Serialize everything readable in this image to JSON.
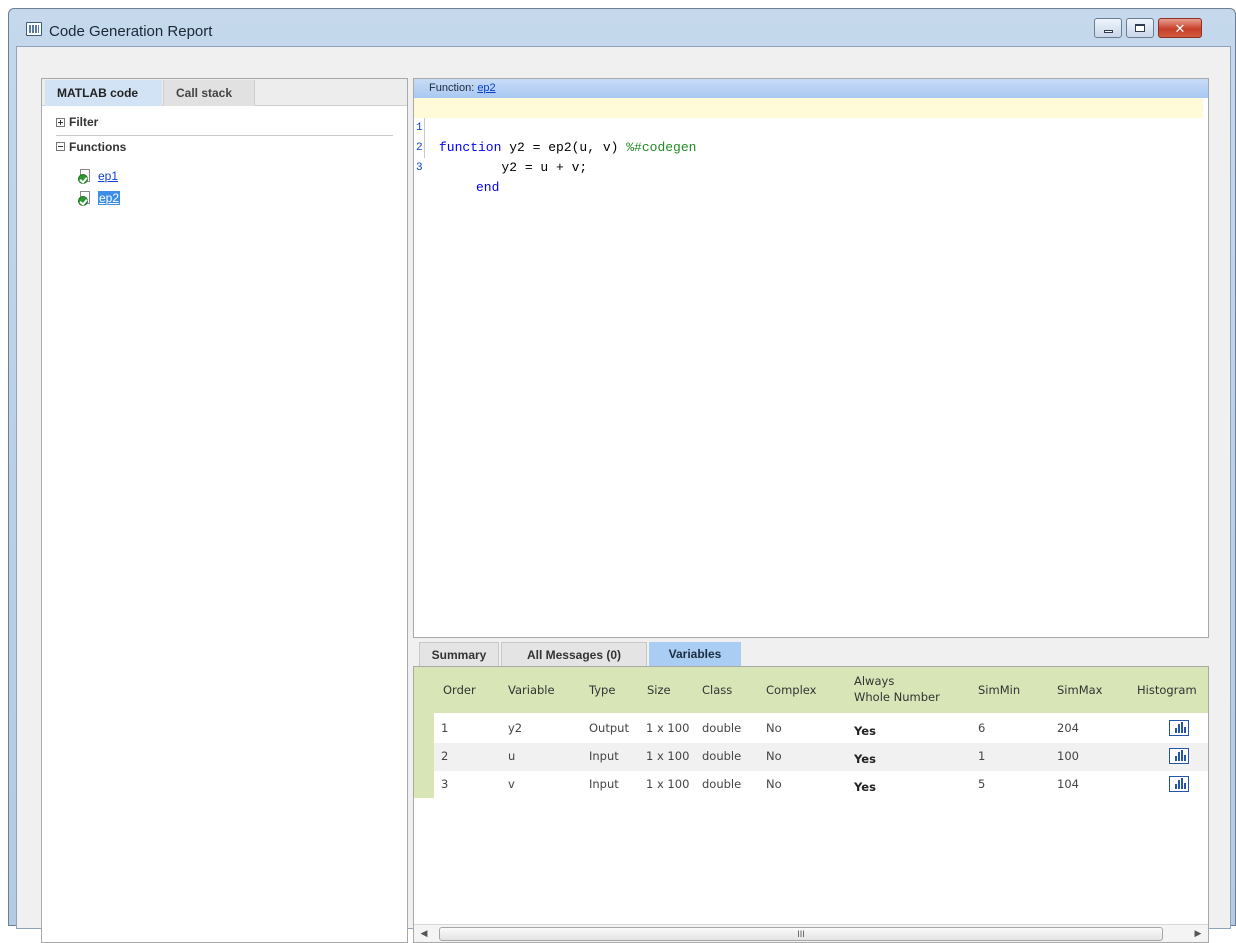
{
  "window": {
    "title": "Code Generation Report",
    "controls": {
      "minimize": "minimize",
      "maximize": "maximize",
      "close": "✕"
    }
  },
  "left_panel": {
    "tabs": [
      {
        "label": "MATLAB code",
        "active": true
      },
      {
        "label": "Call stack",
        "active": false
      }
    ],
    "filter_label": "Filter",
    "functions_label": "Functions",
    "functions": [
      {
        "name": "ep1",
        "selected": false
      },
      {
        "name": "ep2",
        "selected": true
      }
    ]
  },
  "code_panel": {
    "header_label": "Function:",
    "function_link": "ep2",
    "lines": [
      {
        "num": "1",
        "keyword": "function",
        "rest": " y2 = ep2(u, v) ",
        "comment": "%#codegen"
      },
      {
        "num": "2",
        "keyword": "",
        "rest": "        y2 = u + v;",
        "comment": ""
      },
      {
        "num": "3",
        "keyword": "end",
        "rest": "",
        "comment": ""
      }
    ]
  },
  "bottom_panel": {
    "tabs": [
      {
        "label": "Summary"
      },
      {
        "label": "All Messages (0)"
      },
      {
        "label": "Variables",
        "active": true
      }
    ],
    "columns": {
      "order": "Order",
      "variable": "Variable",
      "type": "Type",
      "size": "Size",
      "class": "Class",
      "complex": "Complex",
      "always_line1": "Always",
      "always_line2": "Whole Number",
      "simmin": "SimMin",
      "simmax": "SimMax",
      "histogram": "Histogram"
    },
    "rows": [
      {
        "order": "1",
        "variable": "y2",
        "type": "Output",
        "size": "1 x 100",
        "class": "double",
        "complex": "No",
        "always": "Yes",
        "simmin": "6",
        "simmax": "204"
      },
      {
        "order": "2",
        "variable": "u",
        "type": "Input",
        "size": "1 x 100",
        "class": "double",
        "complex": "No",
        "always": "Yes",
        "simmin": "1",
        "simmax": "100"
      },
      {
        "order": "3",
        "variable": "v",
        "type": "Input",
        "size": "1 x 100",
        "class": "double",
        "complex": "No",
        "always": "Yes",
        "simmin": "5",
        "simmax": "104"
      }
    ],
    "scrollbar_grip": "III"
  },
  "colors": {
    "header_blue": "#a9c9f2",
    "table_header_green": "#d8e6b7",
    "code_highlight": "#fffbd8",
    "link_blue": "#0b3fcc"
  }
}
